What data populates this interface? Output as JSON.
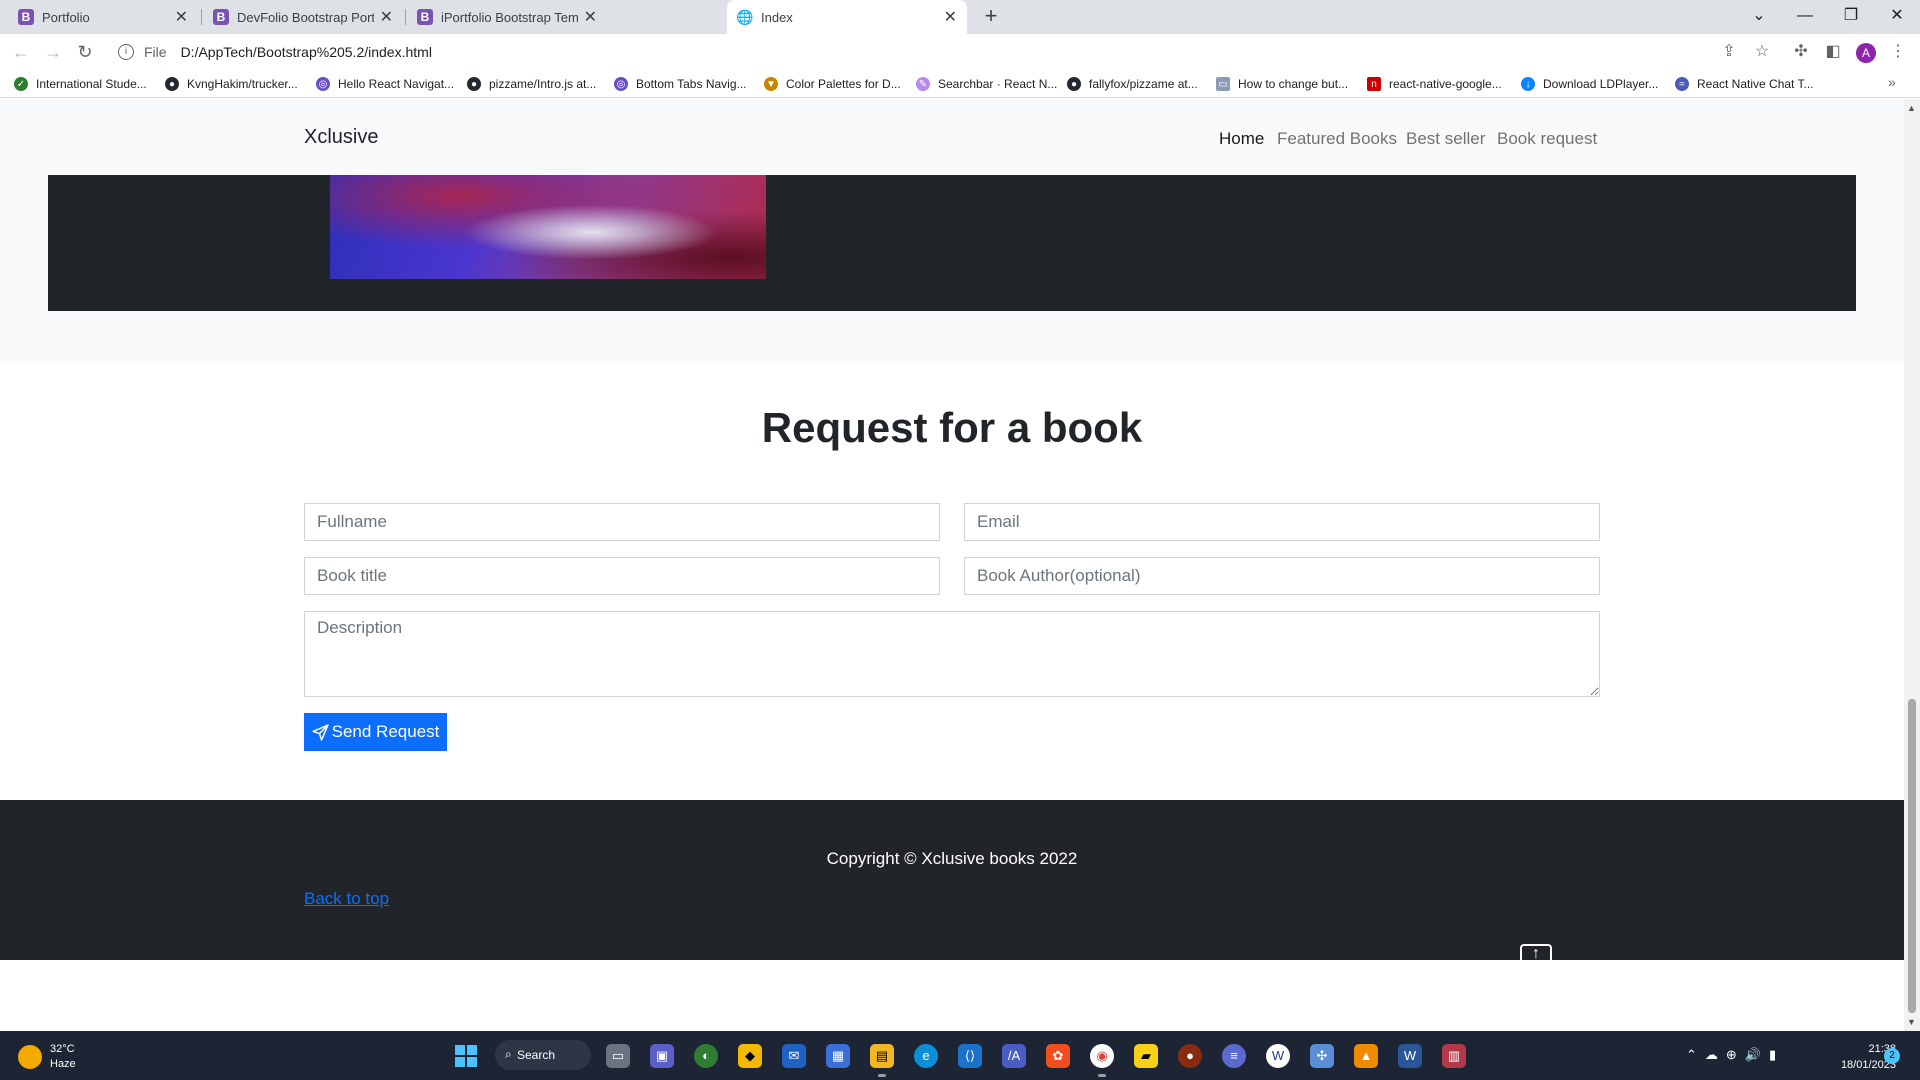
{
  "browser": {
    "tabs": [
      {
        "title": "Portfolio",
        "favicon": "B"
      },
      {
        "title": "DevFolio Bootstrap Portfolio Tem",
        "favicon": "B"
      },
      {
        "title": "iPortfolio Bootstrap Template - Ir",
        "favicon": "B"
      },
      {
        "title": "Index",
        "favicon": "globe"
      }
    ],
    "address": {
      "scheme": "File",
      "url": "D:/AppTech/Bootstrap%205.2/index.html"
    },
    "profile_initial": "A",
    "bookmarks": [
      {
        "label": "International Stude...",
        "color": "#2e7d32"
      },
      {
        "label": "KvngHakim/trucker...",
        "color": "#24292f"
      },
      {
        "label": "Hello React Navigat...",
        "color": "#6a4fc4"
      },
      {
        "label": "pizzame/Intro.js at...",
        "color": "#24292f"
      },
      {
        "label": "Bottom Tabs Navig...",
        "color": "#6a4fc4"
      },
      {
        "label": "Color Palettes for D...",
        "color": "#c78400"
      },
      {
        "label": "Searchbar · React N...",
        "color": "#b58ce8"
      },
      {
        "label": "fallyfox/pizzame at...",
        "color": "#24292f"
      },
      {
        "label": "How to change but...",
        "color": "#8a9bb8"
      },
      {
        "label": "react-native-google...",
        "color": "#cc0000"
      },
      {
        "label": "Download LDPlayer...",
        "color": "#0a84ff"
      },
      {
        "label": "React Native Chat T...",
        "color": "#4a5bb8"
      }
    ]
  },
  "site": {
    "brand": "Xclusive",
    "nav": [
      "Home",
      "Featured Books",
      "Best seller",
      "Book request"
    ],
    "request": {
      "title": "Request for a book",
      "fullname_placeholder": "Fullname",
      "email_placeholder": "Email",
      "book_title_placeholder": "Book title",
      "book_author_placeholder": "Book Author(optional)",
      "description_placeholder": "Description",
      "send_label": "Send Request"
    },
    "footer": {
      "copyright": "Copyright © Xclusive books 2022",
      "back_to_top": "Back to top"
    }
  },
  "taskbar": {
    "weather_temp": "32°C",
    "weather_desc": "Haze",
    "search_label": "Search",
    "time": "21:38",
    "date": "18/01/2023",
    "notifications": "2"
  },
  "colors": {
    "primary": "#0d6efd",
    "dark": "#212529",
    "light": "#f8f9fa"
  }
}
